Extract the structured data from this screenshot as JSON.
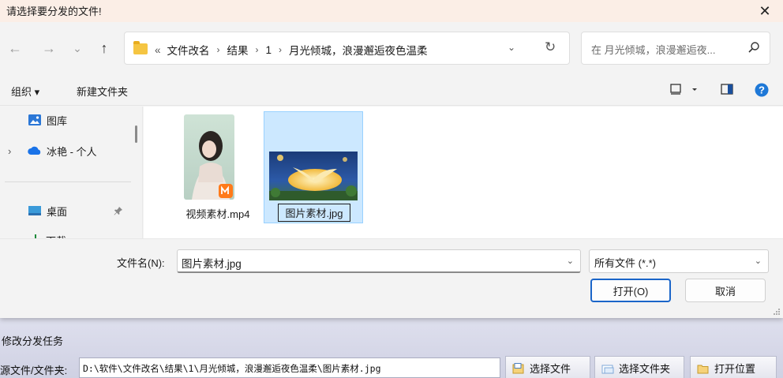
{
  "dialog": {
    "title": "请选择要分发的文件!",
    "close_glyph": "✕"
  },
  "nav": {
    "back_glyph": "←",
    "forward_glyph": "→",
    "recent_glyph": "⌄",
    "up_glyph": "↑",
    "breadcrumb_prefix": "«",
    "breadcrumbs": [
      "文件改名",
      "结果",
      "1",
      "月光倾城，浪漫邂逅夜色温柔"
    ],
    "separator": "›",
    "dropdown_glyph": "⌄",
    "refresh_glyph": "↻",
    "search_placeholder": "在 月光倾城，浪漫邂逅夜..."
  },
  "toolbar": {
    "organize_label": "组织 ▾",
    "new_folder_label": "新建文件夹"
  },
  "sidebar": {
    "items": [
      {
        "label": "图库",
        "icon": "gallery-icon"
      },
      {
        "label": "冰艳 - 个人",
        "icon": "onedrive-cloud-icon",
        "expand": "›"
      },
      {
        "label": "桌面",
        "icon": "desktop-icon",
        "pin": "📌"
      },
      {
        "label": "下载",
        "icon": "download-icon"
      }
    ]
  },
  "files": [
    {
      "name": "视频素材.mp4",
      "type": "video",
      "selected": false
    },
    {
      "name": "图片素材.jpg",
      "type": "image",
      "selected": true
    }
  ],
  "bottom": {
    "filename_label": "文件名(N):",
    "filename_value": "图片素材.jpg",
    "filetype_value": "所有文件 (*.*)",
    "open_label": "打开(O)",
    "cancel_label": "取消"
  },
  "background_app": {
    "section_title": "修改分发任务",
    "source_label": "源文件/文件夹:",
    "source_path": "D:\\软件\\文件改名\\结果\\1\\月光倾城，浪漫邂逅夜色温柔\\图片素材.jpg",
    "select_file_label": "选择文件",
    "select_folder_label": "选择文件夹",
    "open_location_label": "打开位置"
  },
  "colors": {
    "accent": "#1a65c9",
    "selection": "#cce8ff",
    "folder": "#f5c542",
    "help": "#1e78d7"
  }
}
